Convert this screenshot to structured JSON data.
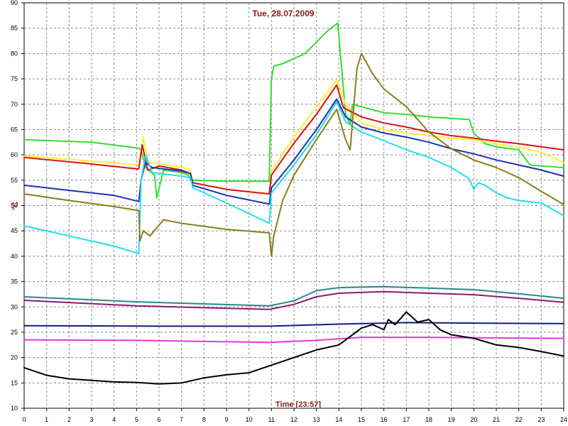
{
  "chart_data": {
    "type": "line",
    "title": "Tue, 28.07.2009",
    "xlabel": "Time [23:57]",
    "ylabel": "°C",
    "xlim": [
      0,
      24
    ],
    "ylim": [
      10,
      90
    ],
    "x_ticks": [
      0,
      1,
      2,
      3,
      4,
      5,
      6,
      7,
      8,
      9,
      10,
      11,
      12,
      13,
      14,
      15,
      16,
      17,
      18,
      19,
      20,
      21,
      22,
      23,
      24
    ],
    "y_ticks": [
      10,
      15,
      20,
      25,
      30,
      35,
      40,
      45,
      50,
      55,
      60,
      65,
      70,
      75,
      80,
      85,
      90
    ],
    "grid": true,
    "series": [
      {
        "color": "#33dd33",
        "points": [
          [
            0,
            63
          ],
          [
            3,
            62.5
          ],
          [
            5.1,
            61.3
          ],
          [
            5.2,
            61
          ],
          [
            5.4,
            57.5
          ],
          [
            5.8,
            56
          ],
          [
            5.9,
            51.5
          ],
          [
            6.2,
            57
          ],
          [
            7,
            56.5
          ],
          [
            7.3,
            56
          ],
          [
            7.4,
            55
          ],
          [
            9,
            54.8
          ],
          [
            10.9,
            54.8
          ],
          [
            11.0,
            75
          ],
          [
            11.1,
            77.5
          ],
          [
            11.5,
            78
          ],
          [
            12.5,
            80
          ],
          [
            13.5,
            84.5
          ],
          [
            13.95,
            86
          ],
          [
            14.3,
            68
          ],
          [
            14.5,
            66
          ],
          [
            14.6,
            70
          ],
          [
            15,
            69.5
          ],
          [
            16,
            68.3
          ],
          [
            17,
            68
          ],
          [
            18,
            67.5
          ],
          [
            19,
            67.2
          ],
          [
            19.8,
            67
          ],
          [
            20,
            64.3
          ],
          [
            20.5,
            62.2
          ],
          [
            21,
            61.6
          ],
          [
            22,
            61
          ],
          [
            22.5,
            58
          ],
          [
            23,
            57.8
          ],
          [
            24,
            57.5
          ]
        ]
      },
      {
        "color": "#ffee33",
        "points": [
          [
            0,
            59.8
          ],
          [
            3,
            58.8
          ],
          [
            5.1,
            58
          ],
          [
            5.3,
            63.5
          ],
          [
            5.5,
            58.5
          ],
          [
            6,
            58.2
          ],
          [
            7,
            57.6
          ],
          [
            7.4,
            57
          ],
          [
            7.5,
            54.5
          ],
          [
            9,
            53.2
          ],
          [
            10.9,
            52.3
          ],
          [
            11.0,
            56.8
          ],
          [
            12,
            63.5
          ],
          [
            13,
            69.5
          ],
          [
            13.9,
            74.8
          ],
          [
            14.3,
            70
          ],
          [
            15,
            66.2
          ],
          [
            16,
            65
          ],
          [
            17,
            64.3
          ],
          [
            18,
            63.8
          ],
          [
            19,
            63.3
          ],
          [
            20,
            63
          ],
          [
            21,
            62.2
          ],
          [
            22,
            61.5
          ],
          [
            23,
            60.5
          ],
          [
            24,
            58.5
          ]
        ]
      },
      {
        "color": "#dd1111",
        "points": [
          [
            0,
            59.5
          ],
          [
            3,
            58.2
          ],
          [
            5.1,
            57.2
          ],
          [
            5.25,
            62
          ],
          [
            5.5,
            57
          ],
          [
            6,
            57.8
          ],
          [
            7,
            57
          ],
          [
            7.4,
            56.3
          ],
          [
            7.5,
            54.5
          ],
          [
            9,
            53.2
          ],
          [
            10.9,
            52.3
          ],
          [
            11.0,
            56
          ],
          [
            12,
            62.3
          ],
          [
            13,
            68
          ],
          [
            13.9,
            73.8
          ],
          [
            14.2,
            69.3
          ],
          [
            15,
            67.5
          ],
          [
            16,
            66.3
          ],
          [
            17,
            65.5
          ],
          [
            18,
            64.5
          ],
          [
            19,
            63.8
          ],
          [
            20,
            63.3
          ],
          [
            21,
            62.7
          ],
          [
            22,
            62.2
          ],
          [
            23,
            61.6
          ],
          [
            24,
            61
          ]
        ]
      },
      {
        "color": "#1a33bb",
        "points": [
          [
            0,
            54
          ],
          [
            2,
            53
          ],
          [
            4,
            52
          ],
          [
            5.1,
            50.8
          ],
          [
            5.2,
            55
          ],
          [
            5.4,
            58.5
          ],
          [
            5.7,
            57.5
          ],
          [
            7,
            56.8
          ],
          [
            7.4,
            56.3
          ],
          [
            7.5,
            54
          ],
          [
            9,
            52
          ],
          [
            10.9,
            50.3
          ],
          [
            11.0,
            53.5
          ],
          [
            12,
            59
          ],
          [
            13,
            65
          ],
          [
            13.9,
            71
          ],
          [
            14.3,
            67.5
          ],
          [
            15,
            65.5
          ],
          [
            16,
            64.3
          ],
          [
            17,
            63.5
          ],
          [
            18,
            62.5
          ],
          [
            19,
            61.2
          ],
          [
            20,
            60.2
          ],
          [
            21,
            59
          ],
          [
            22,
            58
          ],
          [
            23,
            57
          ],
          [
            24,
            55.8
          ]
        ]
      },
      {
        "color": "#22ddee",
        "points": [
          [
            0,
            46
          ],
          [
            2,
            44
          ],
          [
            4,
            42
          ],
          [
            5.1,
            40.5
          ],
          [
            5.2,
            55
          ],
          [
            5.4,
            60
          ],
          [
            5.7,
            56.5
          ],
          [
            7,
            55.8
          ],
          [
            7.4,
            55.5
          ],
          [
            7.5,
            53.5
          ],
          [
            9,
            50.5
          ],
          [
            10.9,
            46.5
          ],
          [
            11.0,
            52.5
          ],
          [
            12,
            58
          ],
          [
            13,
            64
          ],
          [
            13.9,
            70.5
          ],
          [
            14.3,
            66.5
          ],
          [
            15,
            64.5
          ],
          [
            16,
            62.8
          ],
          [
            17,
            61
          ],
          [
            18,
            59.5
          ],
          [
            19,
            57.5
          ],
          [
            19.8,
            55.3
          ],
          [
            20,
            53.2
          ],
          [
            20.2,
            54.5
          ],
          [
            20.5,
            54
          ],
          [
            21,
            52.5
          ],
          [
            21.5,
            51.5
          ],
          [
            22,
            51
          ],
          [
            23,
            50.5
          ],
          [
            24,
            48
          ]
        ]
      },
      {
        "color": "#8a7d1a",
        "points": [
          [
            0,
            52.3
          ],
          [
            2,
            51
          ],
          [
            4,
            49.8
          ],
          [
            5.1,
            49
          ],
          [
            5.15,
            43
          ],
          [
            5.3,
            45
          ],
          [
            5.6,
            44
          ],
          [
            6.2,
            47.2
          ],
          [
            7,
            46.5
          ],
          [
            9,
            45.3
          ],
          [
            10.9,
            44.6
          ],
          [
            11.0,
            40
          ],
          [
            11.1,
            44
          ],
          [
            11.5,
            51
          ],
          [
            12,
            56
          ],
          [
            13,
            63
          ],
          [
            13.9,
            69
          ],
          [
            14.3,
            63
          ],
          [
            14.5,
            61
          ],
          [
            14.8,
            77
          ],
          [
            15,
            80
          ],
          [
            15.5,
            76
          ],
          [
            16,
            73
          ],
          [
            17,
            69.5
          ],
          [
            18,
            64.5
          ],
          [
            19,
            61.2
          ],
          [
            20,
            59
          ],
          [
            21,
            57.5
          ],
          [
            22,
            55.5
          ],
          [
            23,
            52.8
          ],
          [
            24,
            50.2
          ]
        ]
      },
      {
        "color": "#2a8888",
        "points": [
          [
            0,
            32
          ],
          [
            5,
            31
          ],
          [
            10.9,
            30.2
          ],
          [
            12,
            31.2
          ],
          [
            13,
            33.2
          ],
          [
            14,
            33.8
          ],
          [
            16,
            34
          ],
          [
            18,
            33.7
          ],
          [
            20,
            33.4
          ],
          [
            22,
            32.6
          ],
          [
            24,
            31.7
          ]
        ]
      },
      {
        "color": "#8a1a7a",
        "points": [
          [
            0,
            31.3
          ],
          [
            5,
            30.2
          ],
          [
            10.9,
            29.5
          ],
          [
            12,
            30.5
          ],
          [
            13,
            32
          ],
          [
            14,
            32.7
          ],
          [
            16,
            33
          ],
          [
            18,
            32.7
          ],
          [
            20,
            32.4
          ],
          [
            22,
            31.7
          ],
          [
            24,
            30.9
          ]
        ]
      },
      {
        "color": "#10207a",
        "points": [
          [
            0,
            26.3
          ],
          [
            6,
            26.2
          ],
          [
            10.9,
            26.2
          ],
          [
            14,
            26.6
          ],
          [
            17,
            26.9
          ],
          [
            20,
            26.8
          ],
          [
            24,
            26.7
          ]
        ]
      },
      {
        "color": "#ee33dd",
        "points": [
          [
            0,
            23.5
          ],
          [
            5,
            23.4
          ],
          [
            10.9,
            23
          ],
          [
            13,
            23.4
          ],
          [
            15,
            24
          ],
          [
            18,
            24
          ],
          [
            20,
            23.9
          ],
          [
            24,
            23.8
          ]
        ]
      },
      {
        "color": "#000000",
        "points": [
          [
            0,
            18
          ],
          [
            1,
            16.5
          ],
          [
            2,
            15.8
          ],
          [
            3,
            15.5
          ],
          [
            4,
            15.2
          ],
          [
            5,
            15.1
          ],
          [
            6,
            14.8
          ],
          [
            7,
            15
          ],
          [
            8,
            16
          ],
          [
            9,
            16.6
          ],
          [
            10,
            17
          ],
          [
            11,
            18.5
          ],
          [
            12,
            20
          ],
          [
            13,
            21.5
          ],
          [
            14,
            22.5
          ],
          [
            15,
            25.8
          ],
          [
            15.5,
            26.5
          ],
          [
            16,
            25.5
          ],
          [
            16.2,
            27.5
          ],
          [
            16.5,
            26.5
          ],
          [
            17,
            29
          ],
          [
            17.5,
            27
          ],
          [
            18,
            27.5
          ],
          [
            18.5,
            25.5
          ],
          [
            19,
            24.5
          ],
          [
            20,
            23.8
          ],
          [
            21,
            22.5
          ],
          [
            22,
            22
          ],
          [
            23,
            21.2
          ],
          [
            24,
            20.3
          ]
        ]
      }
    ]
  }
}
